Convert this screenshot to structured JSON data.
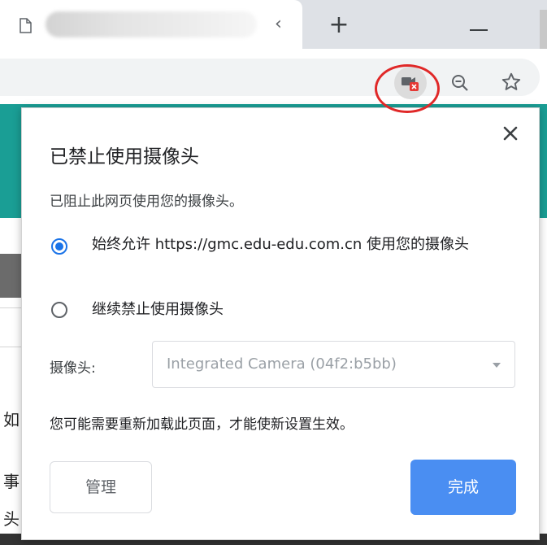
{
  "browser": {
    "tab_close_glyph": "‹",
    "new_tab_glyph": "+"
  },
  "toolbar": {
    "camera_indicator_icon": "camera-blocked-icon",
    "zoom_icon": "zoom-out-icon",
    "bookmark_icon": "star-icon"
  },
  "page_behind": {
    "side_chars": [
      "如",
      "事",
      "头"
    ]
  },
  "permission_bubble": {
    "title": "已禁止使用摄像头",
    "subtitle": "已阻止此网页使用您的摄像头。",
    "options": [
      {
        "label": "始终允许 https://gmc.edu-edu.com.cn 使用您的摄像头",
        "checked": true
      },
      {
        "label": "继续禁止使用摄像头",
        "checked": false
      }
    ],
    "camera_label": "摄像头:",
    "camera_select_value": "Integrated Camera (04f2:b5bb)",
    "reload_note": "您可能需要重新加载此页面，才能使新设置生效。",
    "manage_button": "管理",
    "done_button": "完成"
  },
  "colors": {
    "accent": "#1a73e8",
    "done_button_bg": "#4a8ef2",
    "highlight_ring": "#e02828",
    "page_band": "#1a9e95",
    "blocked_badge": "#e53935"
  }
}
